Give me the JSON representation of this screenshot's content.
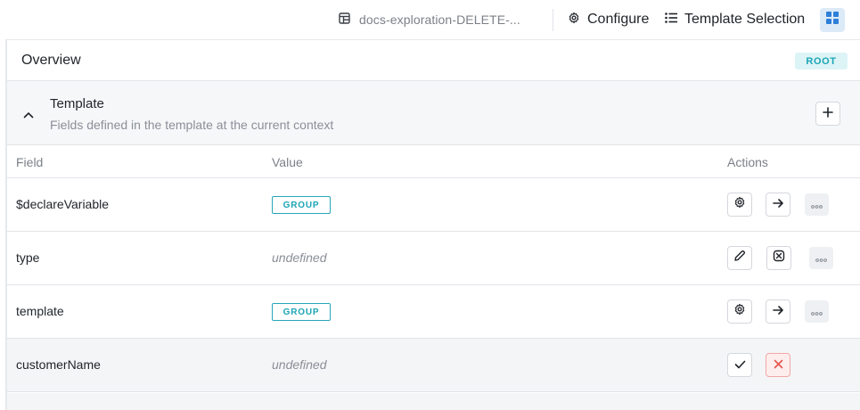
{
  "topbar": {
    "doc_title": "docs-exploration-DELETE-...",
    "configure_label": "Configure",
    "template_selection_label": "Template Selection"
  },
  "overview": {
    "title": "Overview",
    "badge": "ROOT"
  },
  "section": {
    "title": "Template",
    "subtitle": "Fields defined in the template at the current context"
  },
  "table": {
    "headers": {
      "field": "Field",
      "value": "Value",
      "actions": "Actions"
    },
    "rows": [
      {
        "field": "$declareVariable",
        "value": "GROUP"
      },
      {
        "field": "type",
        "value": "undefined"
      },
      {
        "field": "template",
        "value": "GROUP"
      },
      {
        "field": "customerName",
        "value": "undefined"
      }
    ]
  },
  "colors": {
    "accent_teal": "#1ba5b6",
    "grid_blue": "#2e7fd8",
    "cancel_red": "#e5534b"
  },
  "icons": {
    "doc": "layout-icon",
    "configure": "gear-icon",
    "template_selection": "list-icon",
    "grid": "grid-icon",
    "collapse": "chevron-up-icon",
    "add": "plus-icon",
    "settings": "gear-icon",
    "navigate": "arrow-right-icon",
    "more": "more-icon",
    "edit": "pencil-icon",
    "variable": "variable-icon",
    "confirm": "check-icon",
    "cancel": "x-icon"
  }
}
